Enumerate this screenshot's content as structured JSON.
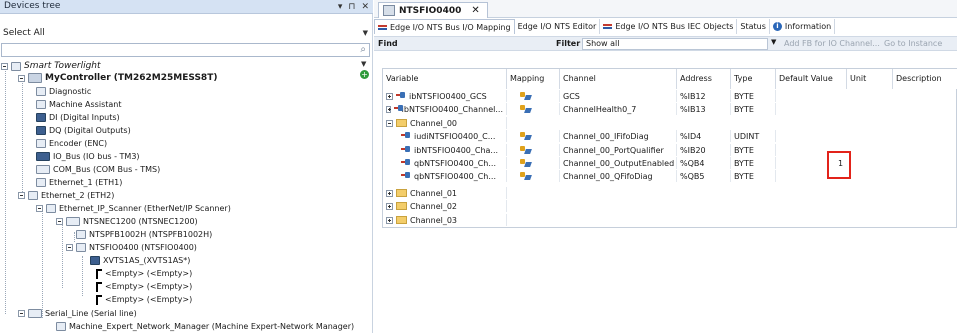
{
  "left_pane": {
    "title": "Devices tree",
    "header_buttons": [
      "▾",
      "⊓",
      "✕"
    ],
    "filter_select": "Select All",
    "tree": [
      {
        "label": "Smart Towerlight",
        "style": "italic"
      },
      {
        "label": "MyController (TM262M25MESS8T)",
        "style": "bold"
      },
      {
        "label": "Diagnostic"
      },
      {
        "label": "Machine Assistant"
      },
      {
        "label": "DI (Digital Inputs)"
      },
      {
        "label": "DQ (Digital Outputs)"
      },
      {
        "label": "Encoder (ENC)"
      },
      {
        "label": "IO_Bus (IO bus - TM3)"
      },
      {
        "label": "COM_Bus (COM Bus - TMS)"
      },
      {
        "label": "Ethernet_1 (ETH1)"
      },
      {
        "label": "Ethernet_2 (ETH2)"
      },
      {
        "label": "Ethernet_IP_Scanner (EtherNet/IP Scanner)"
      },
      {
        "label": "NTSNEC1200 (NTSNEC1200)"
      },
      {
        "label": "NTSPFB1002H (NTSPFB1002H)"
      },
      {
        "label": "NTSFIO0400 (NTSFIO0400)"
      },
      {
        "label": "XVTS1AS_(XVTS1AS*)"
      },
      {
        "label": "<Empty> (<Empty>)"
      },
      {
        "label": "<Empty> (<Empty>)"
      },
      {
        "label": "<Empty> (<Empty>)"
      },
      {
        "label": "Serial_Line (Serial line)"
      },
      {
        "label": "Machine_Expert_Network_Manager (Machine Expert-Network Manager)"
      }
    ]
  },
  "editor": {
    "tab_title": "NTSFIO0400",
    "tab_close": "✕",
    "subtabs": [
      {
        "label": "Edge I/O NTS Bus I/O Mapping",
        "active": true
      },
      {
        "label": "Edge I/O NTS Editor"
      },
      {
        "label": "Edge I/O NTS Bus IEC Objects"
      },
      {
        "label": "Status"
      },
      {
        "label": "Information"
      }
    ],
    "toolbar": {
      "find_label": "Find",
      "filter_label": "Filter",
      "filter_value": "Show all",
      "add_fb": "Add FB for IO Channel...",
      "goto": "Go to Instance"
    },
    "columns": [
      "Variable",
      "Mapping",
      "Channel",
      "Address",
      "Type",
      "Default Value",
      "Unit",
      "Description"
    ],
    "rows": [
      {
        "variable": "ibNTSFIO0400_GCS",
        "channel": "GCS",
        "address": "%IB12",
        "type": "BYTE"
      },
      {
        "variable": "ibNTSFIO0400_Channel...",
        "channel": "ChannelHealth0_7",
        "address": "%IB13",
        "type": "BYTE"
      },
      {
        "variable": "Channel_00",
        "channel": "",
        "address": "",
        "type": ""
      },
      {
        "variable": "iudiNTSFIO0400_C...",
        "channel": "Channel_00_IFifoDiag",
        "address": "%ID4",
        "type": "UDINT"
      },
      {
        "variable": "ibNTSFIO0400_Cha...",
        "channel": "Channel_00_PortQualifier",
        "address": "%IB20",
        "type": "BYTE"
      },
      {
        "variable": "qbNTSFIO0400_Ch...",
        "channel": "Channel_00_OutputEnabled",
        "address": "%QB4",
        "type": "BYTE"
      },
      {
        "variable": "qbNTSFIO0400_Ch...",
        "channel": "Channel_00_QFifoDiag",
        "address": "%QB5",
        "type": "BYTE"
      },
      {
        "variable": "Channel_01",
        "channel": "",
        "address": "",
        "type": ""
      },
      {
        "variable": "Channel_02",
        "channel": "",
        "address": "",
        "type": ""
      },
      {
        "variable": "Channel_03",
        "channel": "",
        "address": "",
        "type": ""
      }
    ],
    "highlighted_value": "1"
  }
}
